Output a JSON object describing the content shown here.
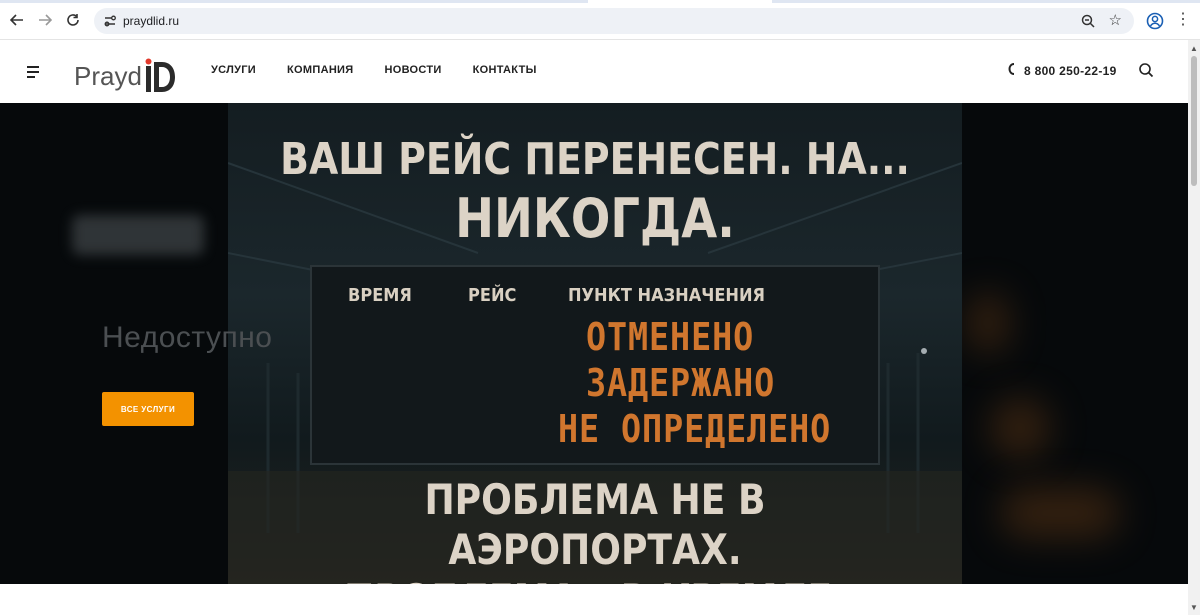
{
  "browser": {
    "url": "praydlid.ru",
    "icons": [
      "back-arrow-icon",
      "forward-arrow-icon",
      "reload-icon",
      "site-settings-icon",
      "zoom-icon",
      "bookmark-star-icon",
      "profile-icon",
      "more-menu-icon"
    ]
  },
  "header": {
    "logo_text": "Prayd",
    "nav": [
      "УСЛУГИ",
      "КОМПАНИЯ",
      "НОВОСТИ",
      "КОНТАКТЫ"
    ],
    "phone": "8 800 250-22-19"
  },
  "hero": {
    "title": "Недоступно",
    "cta_label": "ВСЕ УСЛУГИ",
    "poster": {
      "headline_1": "ВАШ РЕЙС ПЕРЕНЕСЕН. НА...",
      "headline_2": "НИКОГДА.",
      "board_columns": [
        "ВРЕМЯ",
        "РЕЙС",
        "ПУНКТ НАЗНАЧЕНИЯ"
      ],
      "statuses": [
        "ОТМЕНЕНО",
        "ЗАДЕРЖАНО",
        "НЕ ОПРЕДЕЛЕНО"
      ],
      "footer_1": "ПРОБЛЕМА НЕ В АЭРОПОРТАХ.",
      "footer_2": "ПРОБЛЕМА – В КРЕМЛЕ."
    }
  },
  "colors": {
    "accent": "#f39200",
    "status_orange": "#d0762e",
    "logo_red": "#e2392b"
  }
}
